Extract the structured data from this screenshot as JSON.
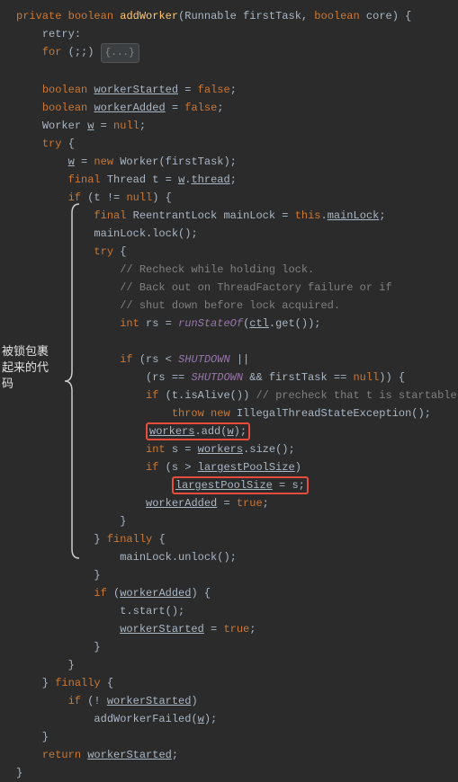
{
  "annotation": "被锁包裹起来的代码",
  "fold": "{...}",
  "s": {
    "private": "private",
    "boolean": "boolean",
    "addWorker": "addWorker",
    "Runnable": "Runnable",
    "firstTask": "firstTask",
    "core": "core",
    "retry": "retry:",
    "for": "for",
    "empty": "(;;)",
    "workerStarted": "workerStarted",
    "workerAdded": "workerAdded",
    "false": "false",
    "true": "true",
    "Worker": "Worker",
    "w": "w",
    "null": "null",
    "try": "try",
    "new": "new",
    "final": "final",
    "Thread": "Thread",
    "t": "t",
    "thread": "thread",
    "if": "if",
    "ReentrantLock": "ReentrantLock",
    "mainLock": "mainLock",
    "this": "this",
    "lock": "lock();",
    "c1": "// Recheck while holding lock.",
    "c2": "// Back out on ThreadFactory failure or if",
    "c3": "// shut down before lock acquired.",
    "c4": "// precheck that t is startable",
    "int": "int",
    "rs": "rs",
    "runStateOf": "runStateOf",
    "ctl": "ctl",
    "get": "get()",
    "SHUTDOWN": "SHUTDOWN",
    "isAlive": "isAlive()",
    "throw": "throw",
    "IllegalThreadStateException": "IllegalThreadStateException();",
    "workers": "workers",
    "add": "add",
    "s": "s",
    "size": "size();",
    "largestPoolSize": "largestPoolSize",
    "finally": "finally",
    "unlock": "unlock();",
    "start": "start();",
    "addWorkerFailed": "addWorkerFailed",
    "return": "return"
  }
}
